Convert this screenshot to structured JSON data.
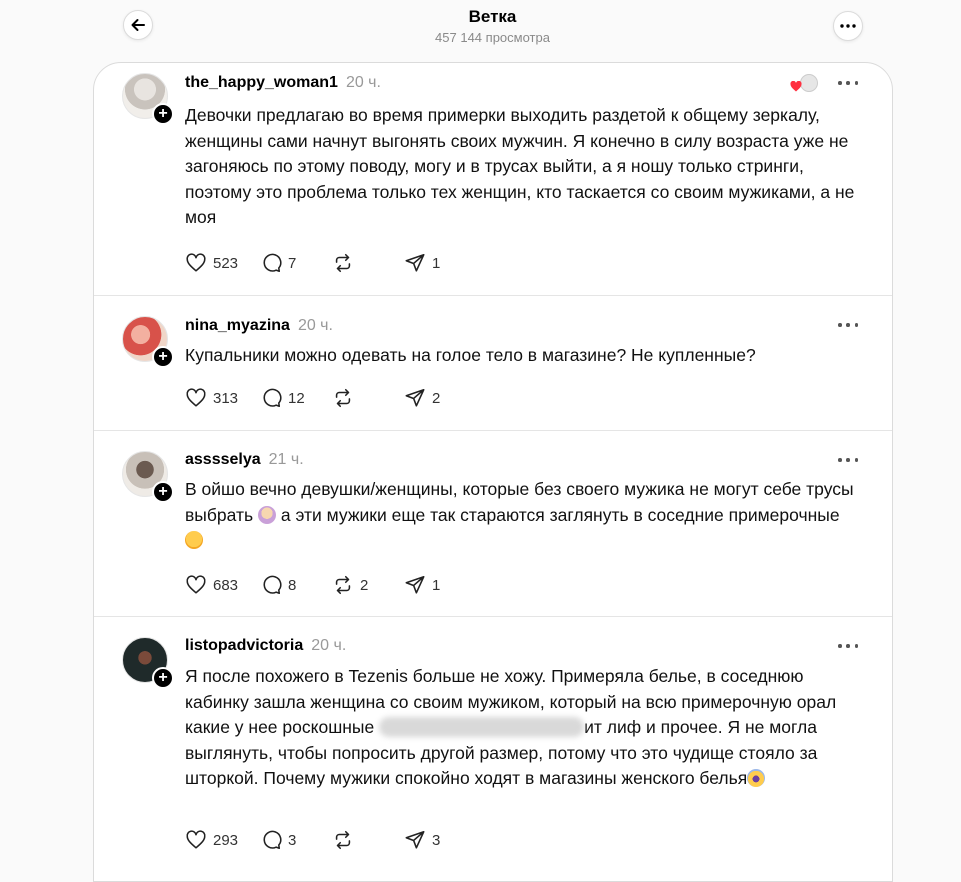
{
  "header": {
    "title": "Ветка",
    "views": "457 144 просмотра"
  },
  "posts": [
    {
      "username": "the_happy_woman1",
      "time": "20 ч.",
      "text": "Девочки предлагаю во время примерки выходить раздетой к общему зеркалу, женщины сами начнут выгонять своих мужчин. Я конечно в силу возраста уже не загоняюсь по этому поводу, могу и в трусах выйти, а я ношу только стринги, поэтому это проблема только тех женщин, кто таскается со своим мужиками, а не моя",
      "likes": "523",
      "comments": "7",
      "reposts": "",
      "shares": "1"
    },
    {
      "username": "nina_myazina",
      "time": "20 ч.",
      "text": "Купальники можно одевать на голое тело в магазине? Не купленные?",
      "likes": "313",
      "comments": "12",
      "reposts": "",
      "shares": "2"
    },
    {
      "username": "asssselya",
      "time": "21 ч.",
      "text_a": "В ойшо вечно девушки/женщины, которые без своего мужика не могут себе трусы выбрать ",
      "text_b": " а эти мужики еще так стараются заглянуть в соседние примерочные",
      "likes": "683",
      "comments": "8",
      "reposts": "2",
      "shares": "1"
    },
    {
      "username": "listopadvictoria",
      "time": "20 ч.",
      "text_a": "Я после похожего в Tezenis больше не хожу. Примеряла белье, в соседнюю кабинку зашла женщина со своим мужиком, который на всю примерочную орал какие у нее роскошные ",
      "text_b": "ит лиф и прочее. Я не могла выглянуть, чтобы попросить другой размер, потому что это чудище стояло за шторкой. Почему мужики спокойно ходят в магазины женского белья",
      "likes": "293",
      "comments": "3",
      "reposts": "",
      "shares": "3"
    }
  ],
  "icons": {
    "back": "arrow-left-icon",
    "more": "more-horizontal-icon",
    "like": "heart-icon",
    "comment": "comment-icon",
    "repost": "repost-icon",
    "share": "share-icon",
    "follow": "plus-icon"
  }
}
